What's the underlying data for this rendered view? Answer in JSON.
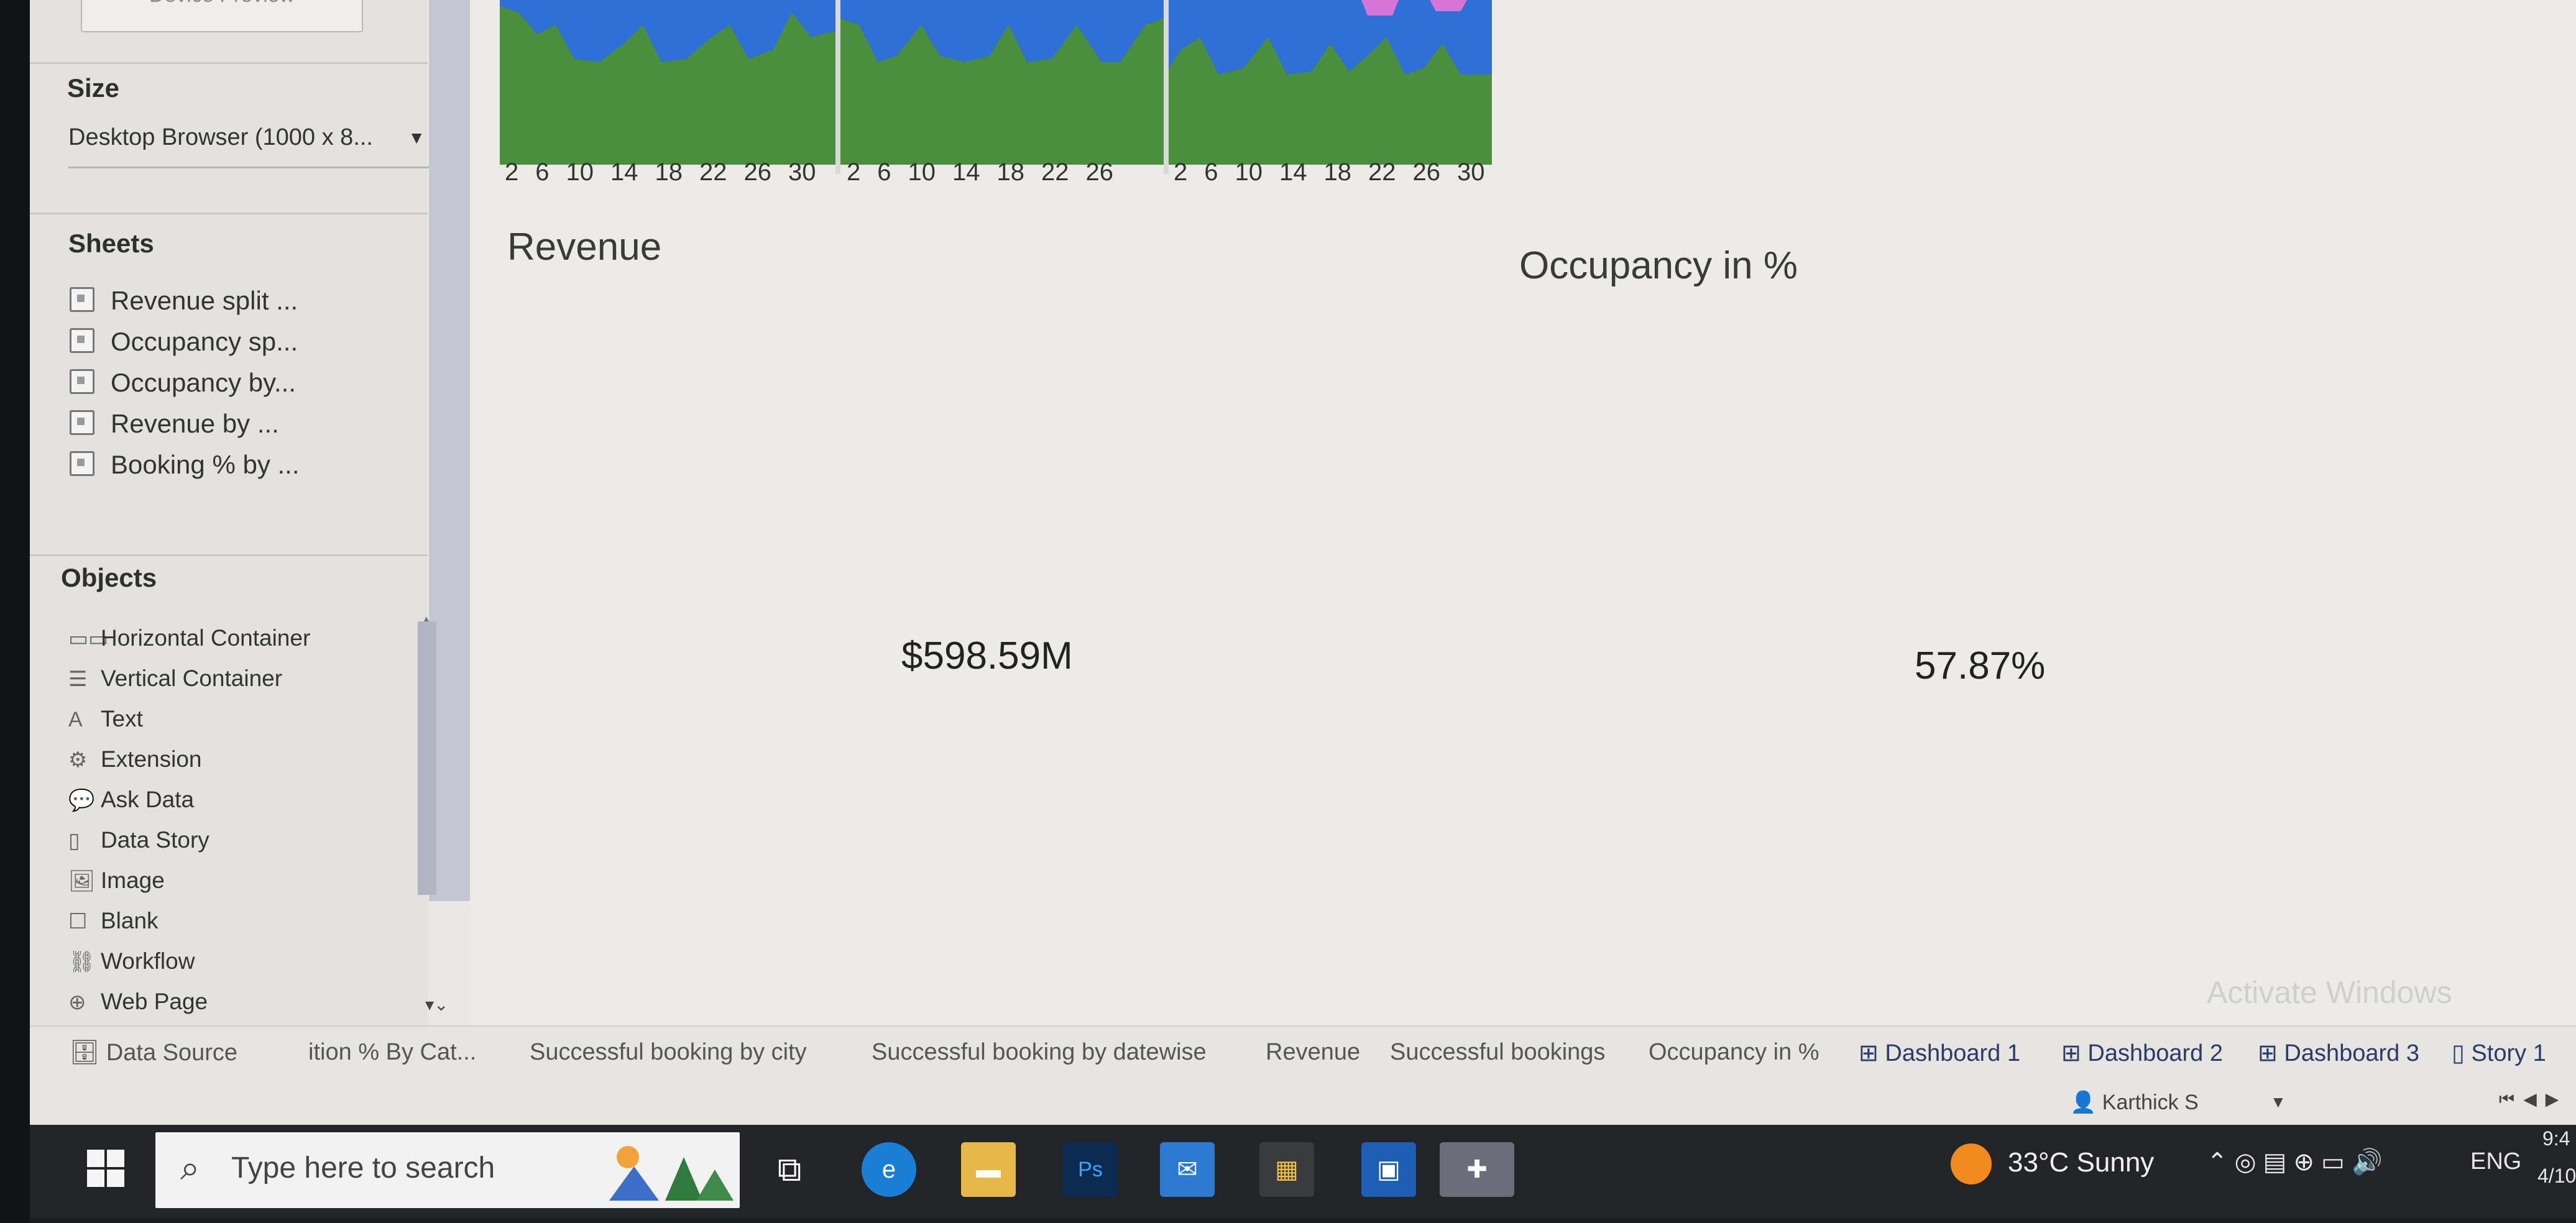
{
  "left_panel": {
    "device_preview_label": "Device Preview",
    "size_title": "Size",
    "size_value": "Desktop Browser (1000 x 8...",
    "sheets_title": "Sheets",
    "sheets": [
      "Revenue split ...",
      "Occupancy sp...",
      "Occupancy by...",
      "Revenue by ...",
      "Booking % by ..."
    ],
    "objects_title": "Objects",
    "objects": [
      {
        "label": "Horizontal Container",
        "icon": "horizontal-container-icon",
        "glyph": "▭▭"
      },
      {
        "label": "Vertical Container",
        "icon": "vertical-container-icon",
        "glyph": "☰"
      },
      {
        "label": "Text",
        "icon": "text-icon",
        "glyph": "A"
      },
      {
        "label": "Extension",
        "icon": "extension-icon",
        "glyph": "⚙"
      },
      {
        "label": "Ask Data",
        "icon": "ask-data-icon",
        "glyph": "💬"
      },
      {
        "label": "Data Story",
        "icon": "data-story-icon",
        "glyph": "▯"
      },
      {
        "label": "Image",
        "icon": "image-icon",
        "glyph": "🖼"
      },
      {
        "label": "Blank",
        "icon": "blank-icon",
        "glyph": "☐"
      },
      {
        "label": "Workflow",
        "icon": "workflow-icon",
        "glyph": "⛓"
      },
      {
        "label": "Web Page",
        "icon": "web-page-icon",
        "glyph": "⊕"
      }
    ]
  },
  "dashboard": {
    "axis_panels": [
      [
        "2",
        "6",
        "10",
        "14",
        "18",
        "22",
        "26",
        "30"
      ],
      [
        "2",
        "6",
        "10",
        "14",
        "18",
        "22",
        "26"
      ],
      [
        "2",
        "6",
        "10",
        "14",
        "18",
        "22",
        "26",
        "30"
      ]
    ],
    "revenue_title": "Revenue",
    "revenue_value": "$598.59M",
    "occupancy_title": "Occupancy in %",
    "occupancy_value": "57.87%",
    "watermark": "Activate Windows"
  },
  "tabs": [
    {
      "label": "Data Source",
      "kind": "datasource"
    },
    {
      "label": "ition % By Cat...",
      "kind": "sheet"
    },
    {
      "label": "Successful booking by city",
      "kind": "sheet"
    },
    {
      "label": "Successful booking by datewise",
      "kind": "sheet"
    },
    {
      "label": "Revenue",
      "kind": "sheet"
    },
    {
      "label": "Successful bookings",
      "kind": "sheet"
    },
    {
      "label": "Occupancy in %",
      "kind": "sheet"
    },
    {
      "label": "Dashboard 1",
      "kind": "dashboard"
    },
    {
      "label": "Dashboard 2",
      "kind": "dashboard"
    },
    {
      "label": "Dashboard 3",
      "kind": "dashboard"
    },
    {
      "label": "Story 1",
      "kind": "story"
    }
  ],
  "user": {
    "name": "Karthick S"
  },
  "taskbar": {
    "search_placeholder": "Type here to search",
    "weather": "33°C  Sunny",
    "language": "ENG",
    "clock_time": "9:4",
    "clock_date": "4/10"
  },
  "colors": {
    "area_green": "#4a8f3c",
    "area_blue": "#2f6fd6",
    "area_pink": "#d774d8",
    "taskbar": "#232427"
  }
}
